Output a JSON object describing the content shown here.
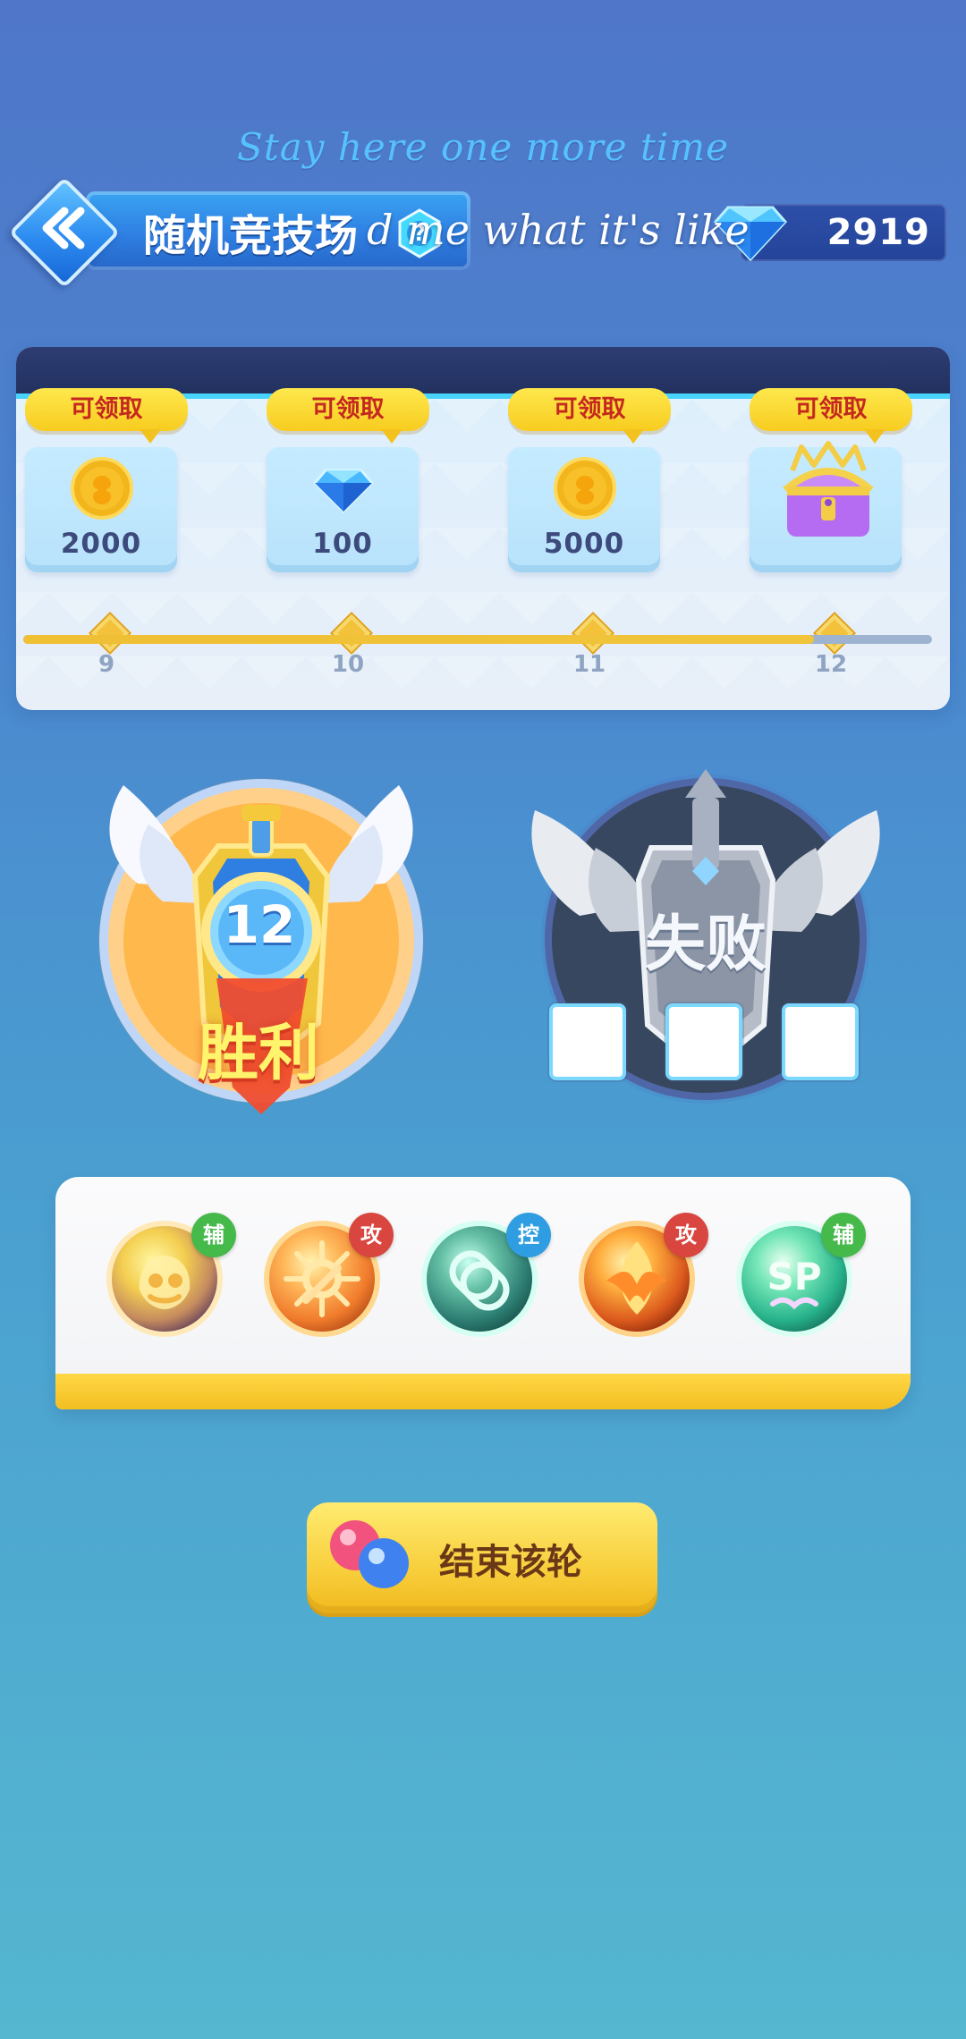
{
  "overlay": {
    "line_1": "Stay here one more time",
    "line_2": "d me what it's like"
  },
  "header": {
    "title": "随机竞技场",
    "currency": {
      "icon": "diamond-icon",
      "amount": "2919"
    },
    "help_icon": "help-icon",
    "back_icon": "back-icon"
  },
  "reward_track": {
    "claim_label": "可领取",
    "progress_percent": 87,
    "items": [
      {
        "icon": "coin-icon",
        "amount": "2000",
        "claim_label": "可领取",
        "milestone": "9"
      },
      {
        "icon": "diamond-icon",
        "amount": "100",
        "claim_label": "可领取",
        "milestone": "10"
      },
      {
        "icon": "coin-icon",
        "amount": "5000",
        "claim_label": "可领取",
        "milestone": "11"
      },
      {
        "icon": "treasure-chest-icon",
        "amount": "",
        "claim_label": "可领取",
        "milestone": "12"
      }
    ]
  },
  "results": {
    "win": {
      "count": "12",
      "label": "胜利"
    },
    "loss": {
      "label": "失败",
      "slots": [
        "",
        "",
        ""
      ]
    }
  },
  "skills": [
    {
      "name": "skill-fireball-icon",
      "tag": "辅",
      "tag_color": "#46b94b",
      "icon": "fire-orb-icon"
    },
    {
      "name": "skill-orange-orb-icon",
      "tag": "攻",
      "tag_color": "#d8463f",
      "icon": "sun-orb-icon"
    },
    {
      "name": "skill-chain-icon",
      "tag": "控",
      "tag_color": "#2f9de1",
      "icon": "chain-orb-icon"
    },
    {
      "name": "skill-phoenix-icon",
      "tag": "攻",
      "tag_color": "#d8463f",
      "icon": "phoenix-orb-icon"
    },
    {
      "name": "skill-sp-icon",
      "tag": "辅",
      "tag_color": "#46b94b",
      "icon": "sp-orb-icon"
    }
  ],
  "footer": {
    "end_round_label": "结束该轮",
    "button_icon": "bubble-orbs-icon"
  }
}
